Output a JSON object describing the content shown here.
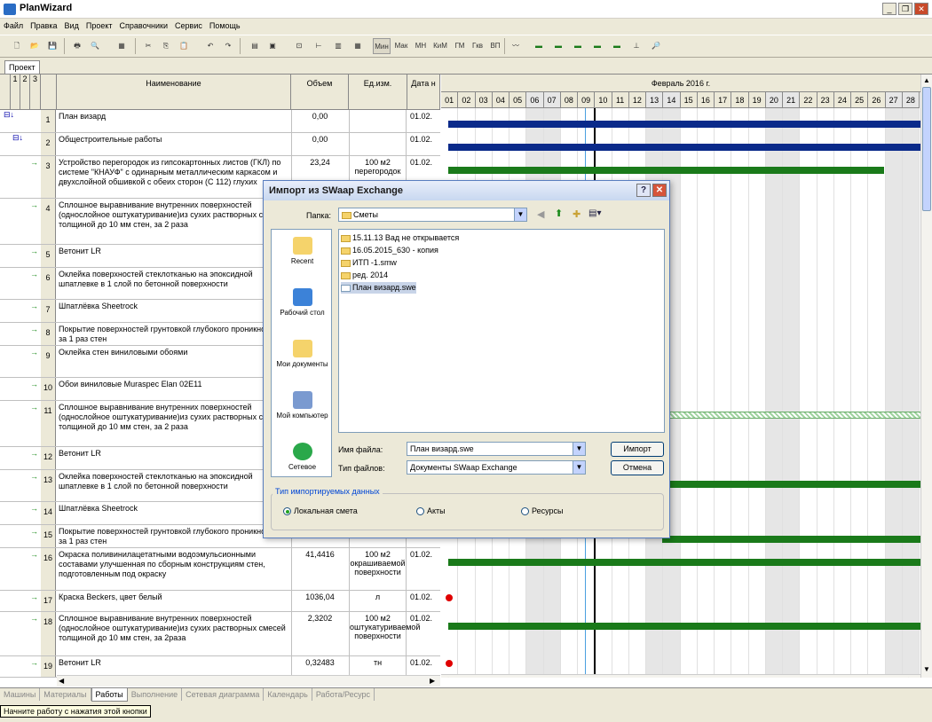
{
  "app": {
    "title": "PlanWizard"
  },
  "menu": [
    "Файл",
    "Правка",
    "Вид",
    "Проект",
    "Справочники",
    "Сервис",
    "Помощь"
  ],
  "toolbar": {
    "buttons": [
      "Мин",
      "Мак",
      "МН",
      "КиМ",
      "ГМ",
      "Гкв",
      "ВП"
    ]
  },
  "project_tab": "Проект",
  "table": {
    "level_headers": [
      "1",
      "2",
      "3"
    ],
    "columns": [
      "Наименование",
      "Объем",
      "Ед.изм.",
      "Дата н"
    ],
    "rows": [
      {
        "n": "1",
        "name": "План визард",
        "vol": "0,00",
        "unit": "",
        "date": "01.02."
      },
      {
        "n": "2",
        "name": "Общестроительные работы",
        "vol": "0,00",
        "unit": "",
        "date": "01.02."
      },
      {
        "n": "3",
        "name": "Устройство перегородок из гипсокартонных листов (ГКЛ) по системе \"КНАУФ\" с одинарным металлическим каркасом и двухслойной обшивкой с обеих сторон (С 112) глухих",
        "vol": "23,24",
        "unit": "100 м2 перегородок",
        "date": "01.02."
      },
      {
        "n": "4",
        "name": "Сплошное выравнивание внутренних поверхностей (однослойное оштукатуривание)из сухих растворных смесей толщиной до 10 мм стен, за 2 раза",
        "vol": "",
        "unit": "",
        "date": ""
      },
      {
        "n": "5",
        "name": "Ветонит LR",
        "vol": "",
        "unit": "",
        "date": ""
      },
      {
        "n": "6",
        "name": "Оклейка поверхностей стеклотканью на эпоксидной шпатлевке в 1 слой по бетонной поверхности",
        "vol": "",
        "unit": "",
        "date": ""
      },
      {
        "n": "7",
        "name": "Шпатлёвка Sheetrock",
        "vol": "",
        "unit": "",
        "date": ""
      },
      {
        "n": "8",
        "name": "Покрытие поверхностей грунтовкой глубокого проникновения за 1 раз стен",
        "vol": "",
        "unit": "",
        "date": ""
      },
      {
        "n": "9",
        "name": "Оклейка стен виниловыми обоями",
        "vol": "",
        "unit": "",
        "date": ""
      },
      {
        "n": "10",
        "name": "Обои виниловые Muraspec Elan 02E11",
        "vol": "",
        "unit": "",
        "date": ""
      },
      {
        "n": "11",
        "name": "Сплошное выравнивание внутренних поверхностей (однослойное оштукатуривание)из сухих растворных смесей толщиной до 10 мм стен, за 2 раза",
        "vol": "",
        "unit": "",
        "date": ""
      },
      {
        "n": "12",
        "name": "Ветонит LR",
        "vol": "",
        "unit": "",
        "date": ""
      },
      {
        "n": "13",
        "name": "Оклейка поверхностей стеклотканью на эпоксидной шпатлевке в 1 слой по бетонной поверхности",
        "vol": "",
        "unit": "",
        "date": ""
      },
      {
        "n": "14",
        "name": "Шпатлёвка Sheetrock",
        "vol": "",
        "unit": "",
        "date": ""
      },
      {
        "n": "15",
        "name": "Покрытие поверхностей грунтовкой глубокого проникновения за 1 раз стен",
        "vol": "",
        "unit": "",
        "date": ""
      },
      {
        "n": "16",
        "name": "Окраска поливинилацетатными водоэмульсионными составами улучшенная по сборным конструкциям стен, подготовленным под окраску",
        "vol": "41,4416",
        "unit": "100 м2 окрашиваемой поверхности",
        "date": "01.02."
      },
      {
        "n": "17",
        "name": "Краска Beckers, цвет белый",
        "vol": "1036,04",
        "unit": "л",
        "date": "01.02."
      },
      {
        "n": "18",
        "name": "Сплошное выравнивание внутренних поверхностей (однослойное оштукатуривание)из сухих растворных смесей толщиной до 10 мм стен, за 2раза",
        "vol": "2,3202",
        "unit": "100 м2 оштукатуриваемой поверхности",
        "date": "01.02."
      },
      {
        "n": "19",
        "name": "Ветонит LR",
        "vol": "0,32483",
        "unit": "тн",
        "date": "01.02."
      }
    ]
  },
  "gantt": {
    "month": "Февраль 2016 г.",
    "days": [
      "01",
      "02",
      "03",
      "04",
      "05",
      "06",
      "07",
      "08",
      "09",
      "10",
      "11",
      "12",
      "13",
      "14",
      "15",
      "16",
      "17",
      "18",
      "19",
      "20",
      "21",
      "22",
      "23",
      "24",
      "25",
      "26",
      "27",
      "28"
    ],
    "weekend_days": [
      "06",
      "07",
      "13",
      "14",
      "20",
      "21",
      "27",
      "28"
    ]
  },
  "dialog": {
    "title": "Импорт из SWaap Exchange",
    "folder_label": "Папка:",
    "folder_value": "Сметы",
    "places": [
      "Recent",
      "Рабочий стол",
      "Мои документы",
      "Мой компьютер",
      "Сетевое"
    ],
    "files": [
      "15.11.13 Вад не открывается",
      "16.05.2015_630 - копия",
      "ИТП -1.smw",
      "ред. 2014",
      "План визард.swe"
    ],
    "filename_label": "Имя файла:",
    "filename_value": "План визард.swe",
    "filetype_label": "Тип файлов:",
    "filetype_value": "Документы SWaap Exchange",
    "import_btn": "Импорт",
    "cancel_btn": "Отмена",
    "group_label": "Тип импортируемых данных",
    "radios": [
      "Локальная смета",
      "Акты",
      "Ресурсы"
    ],
    "radio_selected": "Локальная смета"
  },
  "bottom_tabs": [
    "Машины",
    "Материалы",
    "Работы",
    "Выполнение",
    "Сетевая диаграмма",
    "Календарь",
    "Работа/Ресурс"
  ],
  "bottom_tab_active": "Работы",
  "status": {
    "tooltip": "Начните работу с нажатия этой кнопки"
  },
  "colors": {
    "summary_bar": "#0a2a8a",
    "task_bar": "#1a7a1a",
    "milestone": "#e00000",
    "today_line": "#000000"
  }
}
